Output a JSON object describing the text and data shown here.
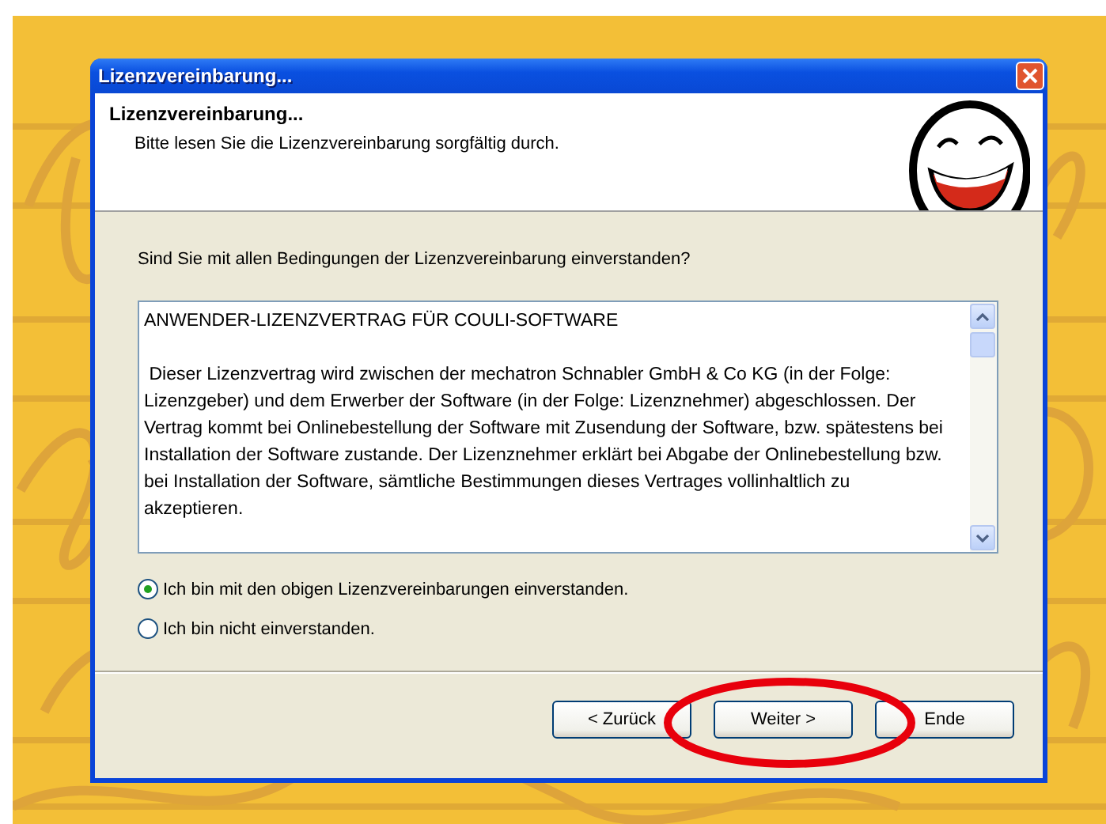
{
  "window": {
    "title": "Lizenzvereinbarung..."
  },
  "header": {
    "title": "Lizenzvereinbarung...",
    "subtitle": "Bitte lesen Sie die Lizenzvereinbarung sorgfältig durch."
  },
  "question": "Sind Sie mit allen Bedingungen der Lizenzvereinbarung einverstanden?",
  "license_text": {
    "paragraphs": [
      "ANWENDER-LIZENZVERTRAG FÜR COULI-SOFTWARE",
      " Dieser Lizenzvertrag wird zwischen der mechatron Schnabler GmbH & Co KG (in der Folge: Lizenzgeber) und dem Erwerber der Software (in der Folge: Lizenznehmer) abgeschlossen. Der Vertrag kommt bei Onlinebestellung der Software mit Zusendung der Software, bzw. spätestens bei Installation der Software zustande. Der Lizenznehmer erklärt bei Abgabe der Onlinebestellung bzw. bei Installation der Software, sämtliche Bestimmungen dieses Vertrages vollinhaltlich zu akzeptieren."
    ]
  },
  "options": [
    {
      "label": "Ich bin mit den obigen Lizenzvereinbarungen einverstanden.",
      "selected": true
    },
    {
      "label": "Ich bin nicht einverstanden.",
      "selected": false
    }
  ],
  "buttons": [
    {
      "label": "< Zurück"
    },
    {
      "label": "Weiter >"
    },
    {
      "label": "Ende"
    }
  ],
  "annotation": {
    "kind": "ellipse"
  }
}
